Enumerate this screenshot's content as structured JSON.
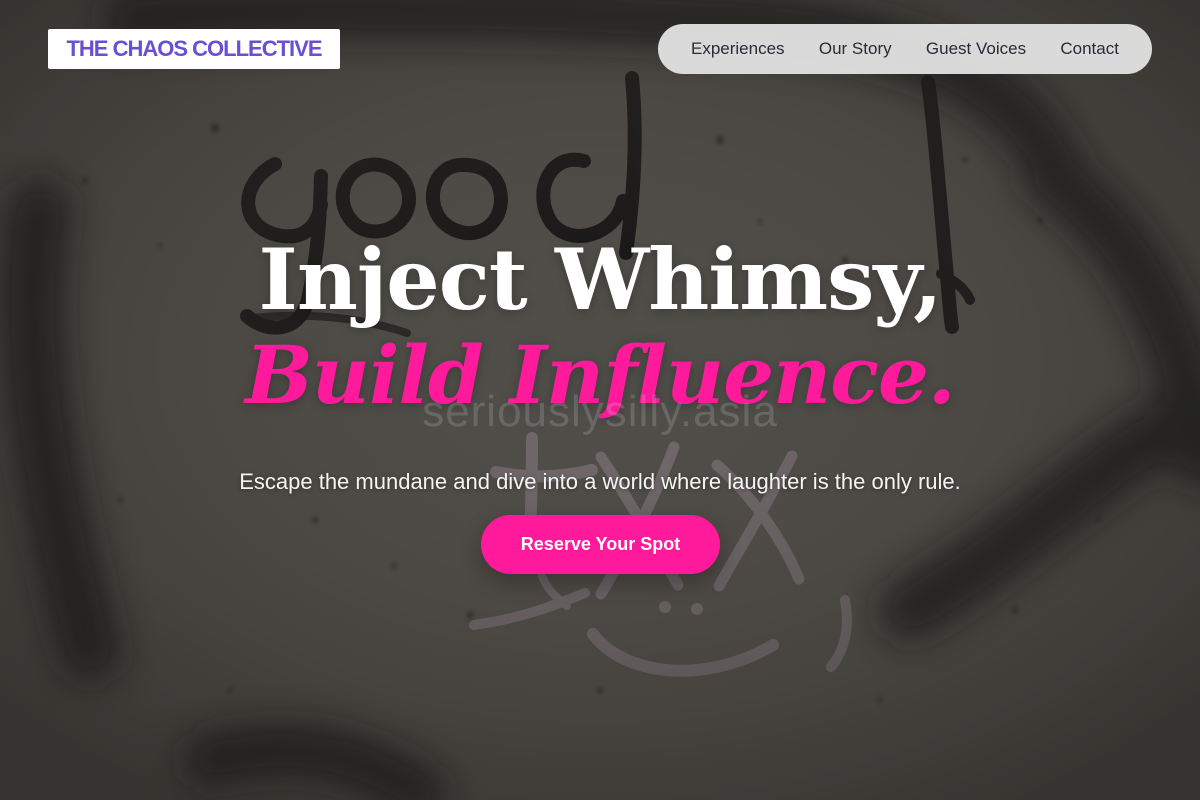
{
  "brand": {
    "logo_text": "THE CHAOS COLLECTIVE"
  },
  "nav": {
    "items": [
      {
        "label": "Experiences"
      },
      {
        "label": "Our Story"
      },
      {
        "label": "Guest Voices"
      },
      {
        "label": "Contact"
      }
    ]
  },
  "hero": {
    "headline_line1": "Inject Whimsy,",
    "headline_line2": "Build Influence.",
    "watermark_text": "seriouslysilly.asia",
    "subheadline": "Escape the mundane and dive into a world where laughter is the only rule.",
    "cta_label": "Reserve Your Spot",
    "background_subject": "graffiti wall with the word good",
    "graffiti_text": "good"
  },
  "colors": {
    "accent": "#ff1a9c",
    "brand": "#6a4fd2",
    "headline": "#ffffff",
    "nav_background": "#e6e6e6",
    "nav_text": "#2a2a38"
  },
  "icons": []
}
